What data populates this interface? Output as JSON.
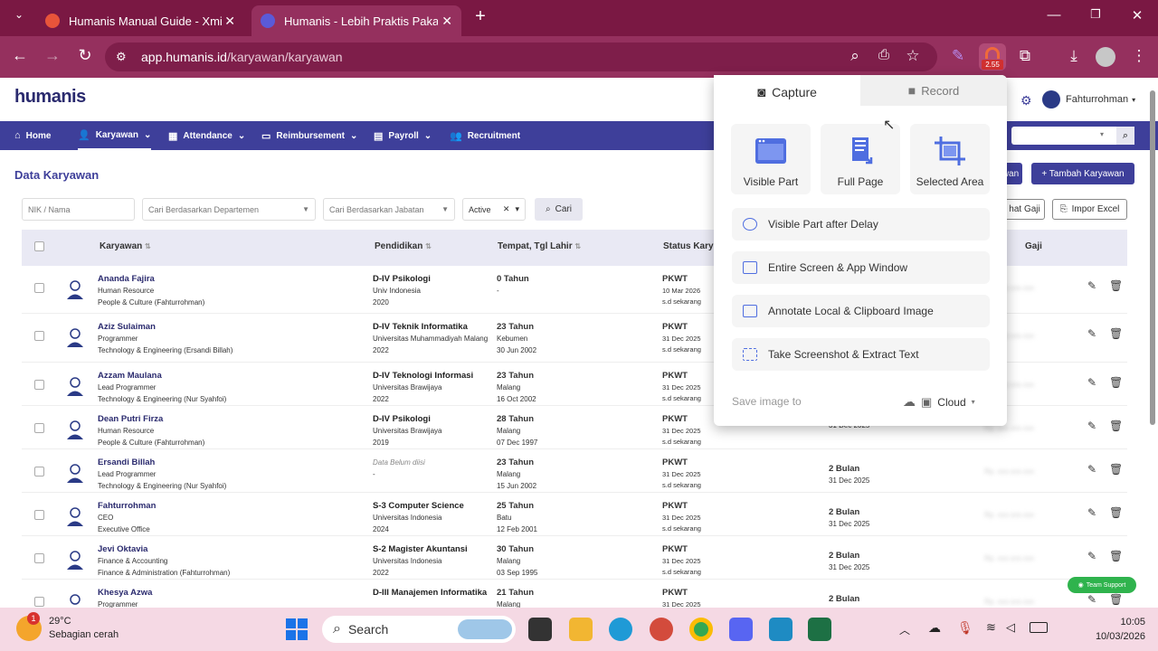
{
  "browser": {
    "tabs": [
      {
        "title": "Humanis Manual Guide - Xmind"
      },
      {
        "title": "Humanis - Lebih Praktis Pakai Humanis"
      }
    ],
    "url_host": "app.humanis.id",
    "url_path": "/karyawan/karyawan",
    "extension_badge": "2.55"
  },
  "app": {
    "logo": "humanis",
    "user": "Fahturrohman",
    "nav": [
      {
        "label": "Home"
      },
      {
        "label": "Karyawan"
      },
      {
        "label": "Attendance"
      },
      {
        "label": "Reimbursement"
      },
      {
        "label": "Payroll"
      },
      {
        "label": "Recruitment"
      }
    ],
    "page_title": "Data Karyawan",
    "filters": {
      "nik_placeholder": "NIK / Nama",
      "dept_placeholder": "Cari Berdasarkan Departemen",
      "jabatan_placeholder": "Cari Berdasarkan Jabatan",
      "status_value": "Active",
      "cari_label": "Cari"
    },
    "buttons": {
      "partial_left": "wan",
      "tambah": "+ Tambah Karyawan",
      "lihat_gaji": "hat Gaji",
      "impor_excel": "Impor Excel"
    },
    "columns": [
      "Karyawan",
      "Pendidikan",
      "Tempat, Tgl Lahir",
      "Status Kary",
      "Gaji"
    ],
    "employees": [
      {
        "name": "Ananda Fajira",
        "role": "Human Resource",
        "dept": "People & Culture (Fahturrohman)",
        "edu_title": "D-IV Psikologi",
        "edu_school": "Univ Indonesia",
        "edu_year": "2020",
        "age": "0 Tahun",
        "place": "",
        "birth": "-",
        "status": "PKWT",
        "start": "10 Mar 2026",
        "until": "s.d sekarang",
        "contract": "",
        "contract_end": "",
        "salary": "Rp. xxx.xxx.xxx"
      },
      {
        "name": "Aziz Sulaiman",
        "role": "Programmer",
        "dept": "Technology & Engineering (Ersandi Billah)",
        "edu_title": "D-IV Teknik Informatika",
        "edu_school": "Universitas Muhammadiyah Malang",
        "edu_year": "2022",
        "age": "23 Tahun",
        "place": "Kebumen",
        "birth": "30 Jun 2002",
        "status": "PKWT",
        "start": "31 Dec 2025",
        "until": "s.d sekarang",
        "contract": "",
        "contract_end": "",
        "salary": "Rp. xxx.xxx.xxx"
      },
      {
        "name": "Azzam Maulana",
        "role": "Lead Programmer",
        "dept": "Technology & Engineering (Nur Syahfoi)",
        "edu_title": "D-IV Teknologi Informasi",
        "edu_school": "Universitas Brawijaya",
        "edu_year": "2022",
        "age": "23 Tahun",
        "place": "Malang",
        "birth": "16 Oct 2002",
        "status": "PKWT",
        "start": "31 Dec 2025",
        "until": "s.d sekarang",
        "contract": "",
        "contract_end": "",
        "salary": "Rp. xxx.xxx.xxx"
      },
      {
        "name": "Dean Putri Firza",
        "role": "Human Resource",
        "dept": "People & Culture (Fahturrohman)",
        "edu_title": "D-IV Psikologi",
        "edu_school": "Universitas Brawijaya",
        "edu_year": "2019",
        "age": "28 Tahun",
        "place": "Malang",
        "birth": "07 Dec 1997",
        "status": "PKWT",
        "start": "31 Dec 2025",
        "until": "s.d sekarang",
        "contract": "",
        "contract_end": "31 Dec 2025",
        "salary": "Rp. xxx.xxx.xxx"
      },
      {
        "name": "Ersandi Billah",
        "role": "Lead Programmer",
        "dept": "Technology & Engineering (Nur Syahfoi)",
        "edu_title": "",
        "edu_school": "Data Belum diisi",
        "edu_year": "-",
        "age": "23 Tahun",
        "place": "Malang",
        "birth": "15 Jun 2002",
        "status": "PKWT",
        "start": "31 Dec 2025",
        "until": "s.d sekarang",
        "contract": "2 Bulan",
        "contract_end": "31 Dec 2025",
        "salary": "Rp. xxx.xxx.xxx"
      },
      {
        "name": "Fahturrohman",
        "role": "CEO",
        "dept": "Executive Office",
        "edu_title": "S-3 Computer Science",
        "edu_school": "Universitas Indonesia",
        "edu_year": "2024",
        "age": "25 Tahun",
        "place": "Batu",
        "birth": "12 Feb 2001",
        "status": "PKWT",
        "start": "31 Dec 2025",
        "until": "s.d sekarang",
        "contract": "2 Bulan",
        "contract_end": "31 Dec 2025",
        "salary": "Rp. xxx.xxx.xxx"
      },
      {
        "name": "Jevi Oktavia",
        "role": "Finance & Accounting",
        "dept": "Finance & Administration (Fahturrohman)",
        "edu_title": "S-2 Magister Akuntansi",
        "edu_school": "Universitas Indonesia",
        "edu_year": "2022",
        "age": "30 Tahun",
        "place": "Malang",
        "birth": "03 Sep 1995",
        "status": "PKWT",
        "start": "31 Dec 2025",
        "until": "s.d sekarang",
        "contract": "2 Bulan",
        "contract_end": "31 Dec 2025",
        "salary": "Rp. xxx.xxx.xxx"
      },
      {
        "name": "Khesya Azwa",
        "role": "Programmer",
        "dept": "",
        "edu_title": "D-III Manajemen Informatika",
        "edu_school": "",
        "edu_year": "",
        "age": "21 Tahun",
        "place": "Malang",
        "birth": "",
        "status": "PKWT",
        "start": "31 Dec 2025",
        "until": "",
        "contract": "2 Bulan",
        "contract_end": "",
        "salary": "Rp. xxx.xxx.xxx"
      }
    ],
    "team_support": "Team Support"
  },
  "capture_popup": {
    "tab_capture": "Capture",
    "tab_record": "Record",
    "modes": [
      {
        "label": "Visible Part",
        "icon": "visible-part-icon"
      },
      {
        "label": "Full Page",
        "icon": "full-page-icon"
      },
      {
        "label": "Selected Area",
        "icon": "selected-area-icon"
      }
    ],
    "options": [
      {
        "label": "Visible Part after Delay"
      },
      {
        "label": "Entire Screen & App Window"
      },
      {
        "label": "Annotate Local & Clipboard Image"
      },
      {
        "label": "Take Screenshot & Extract Text"
      }
    ],
    "save_label": "Save image to",
    "save_target": "Cloud"
  },
  "taskbar": {
    "temp": "29°C",
    "weather": "Sebagian cerah",
    "weather_badge": "1",
    "search": "Search",
    "time": "10:05",
    "date": "10/03/2026"
  },
  "colors": {
    "brand": "#3e3f9a",
    "browser_frame": "#7a1843",
    "accent": "#4f6ee0"
  }
}
